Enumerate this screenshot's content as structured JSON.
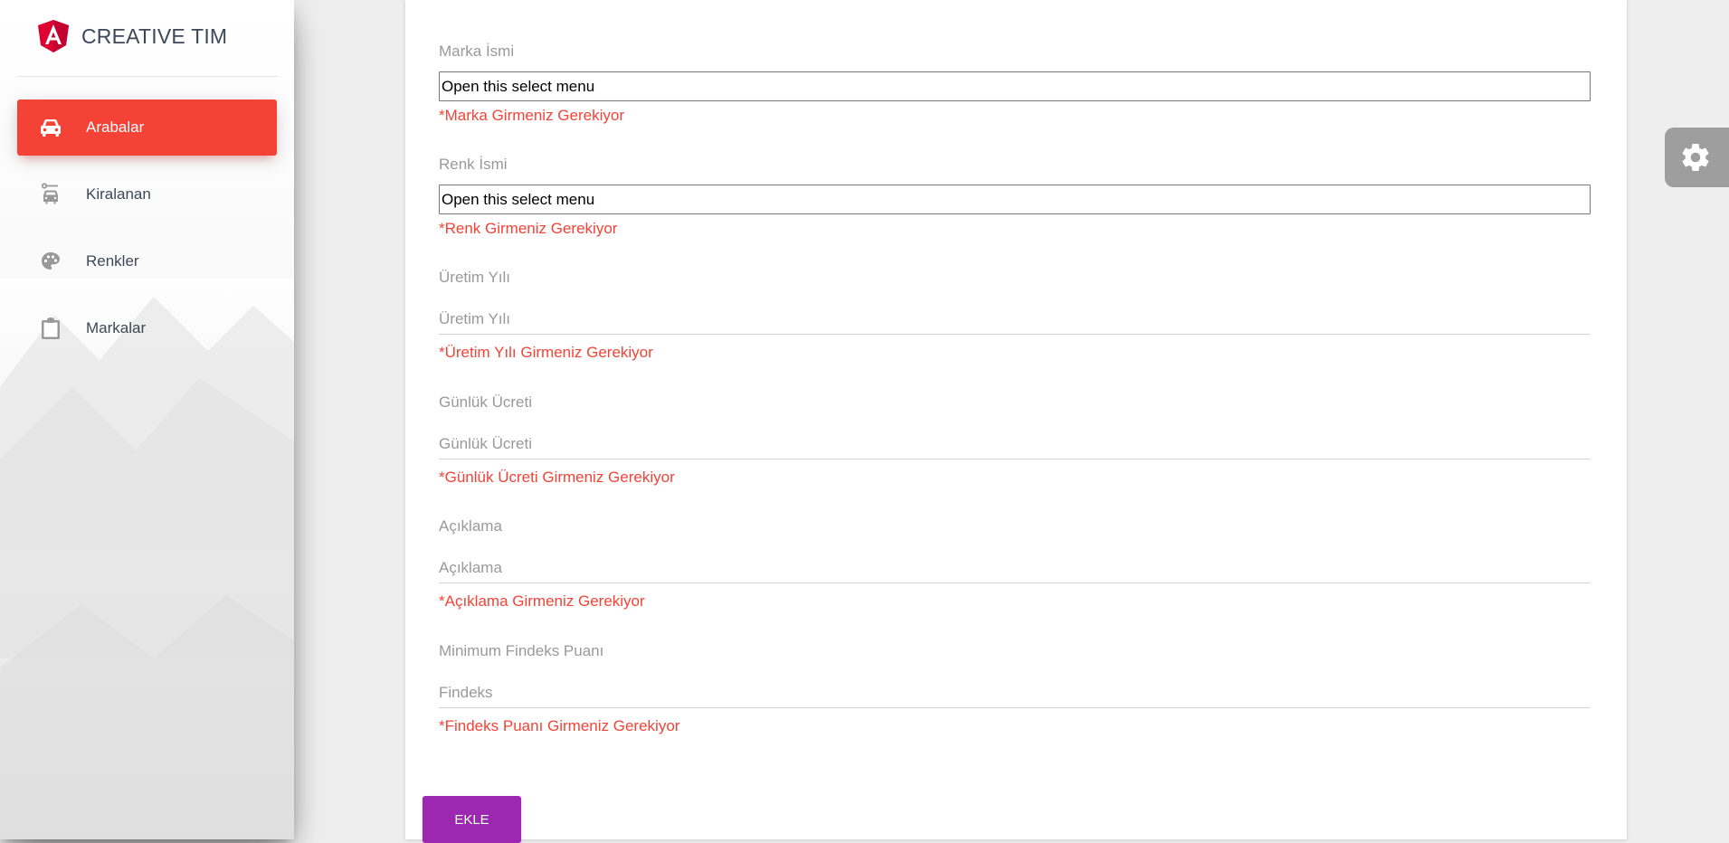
{
  "brand": {
    "name": "CREATIVE TIM",
    "logo_icon": "angular-icon",
    "accent_color": "#f44336"
  },
  "sidebar": {
    "items": [
      {
        "label": "Arabalar",
        "icon": "car-icon",
        "active": true
      },
      {
        "label": "Kiralanan",
        "icon": "transfer-icon",
        "active": false
      },
      {
        "label": "Renkler",
        "icon": "palette-icon",
        "active": false
      },
      {
        "label": "Markalar",
        "icon": "clipboard-icon",
        "active": false
      }
    ]
  },
  "form": {
    "brand": {
      "label": "Marka İsmi",
      "value": "Open this select menu",
      "error": "*Marka Girmeniz Gerekiyor"
    },
    "color": {
      "label": "Renk İsmi",
      "value": "Open this select menu",
      "error": "*Renk Girmeniz Gerekiyor"
    },
    "year": {
      "label": "Üretim Yılı",
      "placeholder": "Üretim Yılı",
      "error": "*Üretim Yılı Girmeniz Gerekiyor"
    },
    "daily_price": {
      "label": "Günlük Ücreti",
      "placeholder": "Günlük Ücreti",
      "error": "*Günlük Ücreti Girmeniz Gerekiyor"
    },
    "description": {
      "label": "Açıklama",
      "placeholder": "Açıklama",
      "error": "*Açıklama Girmeniz Gerekiyor"
    },
    "findeks": {
      "label": "Minimum Findeks Puanı",
      "placeholder": "Findeks",
      "error": "*Findeks Puanı Girmeniz Gerekiyor"
    },
    "submit_label": "EKLE",
    "submit_color": "#9c27b0",
    "error_color": "#f44336"
  },
  "settings": {
    "icon": "gear-icon"
  }
}
